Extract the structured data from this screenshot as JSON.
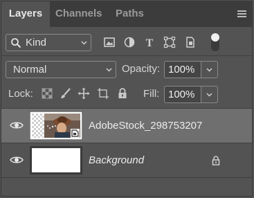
{
  "tabs": [
    {
      "label": "Layers",
      "active": true
    },
    {
      "label": "Channels",
      "active": false
    },
    {
      "label": "Paths",
      "active": false
    }
  ],
  "filter": {
    "kind_label": "Kind",
    "icons": [
      "pixel-layer-filter-icon",
      "adjustment-layer-filter-icon",
      "type-layer-filter-icon",
      "shape-layer-filter-icon",
      "smart-object-filter-icon"
    ],
    "toggle_on": true
  },
  "blend": {
    "mode": "Normal",
    "opacity_label": "Opacity:",
    "opacity_value": "100%"
  },
  "lock": {
    "label": "Lock:",
    "icons": [
      "lock-transparent-pixels-icon",
      "lock-image-pixels-icon",
      "lock-position-icon",
      "lock-artboard-icon",
      "lock-all-icon"
    ],
    "fill_label": "Fill:",
    "fill_value": "100%"
  },
  "layers": [
    {
      "name": "AdobeStock_298753207",
      "visible": true,
      "selected": true,
      "smart_object": true,
      "italic": false,
      "locked": false
    },
    {
      "name": "Background",
      "visible": true,
      "selected": false,
      "smart_object": false,
      "italic": true,
      "locked": true
    }
  ],
  "colors": {
    "panel_bg": "#535353",
    "tabbar_bg": "#3c3c3c",
    "selected_row": "#6f6f6f",
    "text": "#d6d6d6"
  }
}
